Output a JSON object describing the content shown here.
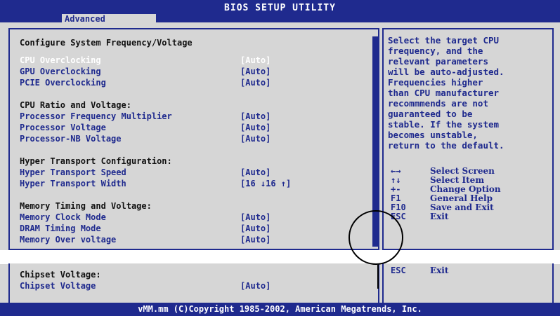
{
  "header": {
    "title": "BIOS SETUP UTILITY",
    "active_tab": "Advanced"
  },
  "main": {
    "heading": "Configure System Frequency/Voltage",
    "rows": [
      {
        "label": "CPU Overclocking",
        "value": "[Auto]",
        "selected": true
      },
      {
        "label": "GPU Overclocking",
        "value": "[Auto]"
      },
      {
        "label": "PCIE Overclocking",
        "value": "[Auto]"
      },
      {
        "section": "CPU Ratio and Voltage:"
      },
      {
        "label": "Processor Frequency Multiplier",
        "value": "[Auto]"
      },
      {
        "label": "Processor Voltage",
        "value": "[Auto]"
      },
      {
        "label": "Processor-NB Voltage",
        "value": "[Auto]"
      },
      {
        "section": "Hyper Transport Configuration:"
      },
      {
        "label": "Hyper Transport Speed",
        "value": "[Auto]"
      },
      {
        "label": "Hyper Transport Width",
        "value": "[16 ↓16 ↑]"
      },
      {
        "section": "Memory Timing and Voltage:"
      },
      {
        "label": "Memory Clock Mode",
        "value": "[Auto]"
      },
      {
        "label": "DRAM Timing Mode",
        "value": "[Auto]"
      },
      {
        "label": "Memory Over voltage",
        "value": "[Auto]"
      }
    ]
  },
  "help": {
    "lines": [
      "Select the target CPU",
      "frequency, and the",
      "relevant parameters",
      "will be auto-adjusted.",
      "Frequencies higher",
      "than CPU manufacturer",
      "recommmends are not",
      "guaranteed to be",
      "stable. If the system",
      "becomes unstable,",
      "return to the default."
    ],
    "keys": [
      {
        "key": "←→",
        "desc": "Select Screen"
      },
      {
        "key": "↑↓",
        "desc": "Select Item"
      },
      {
        "key": "+-",
        "desc": "Change Option"
      },
      {
        "key": "F1",
        "desc": "General Help"
      },
      {
        "key": "F10",
        "desc": "Save and Exit"
      },
      {
        "key": "ESC",
        "desc": "Exit"
      }
    ]
  },
  "bottom": {
    "section": "Chipset Voltage:",
    "row": {
      "label": "Chipset Voltage",
      "value": "[Auto]"
    },
    "help_key": "ESC",
    "help_desc": "Exit"
  },
  "footer": {
    "copyright": "vMM.mm (C)Copyright 1985-2002, American Megatrends, Inc."
  },
  "colors": {
    "bios_blue": "#1f2a8e",
    "bios_gray": "#d6d6d6",
    "selected_text": "#ffffff"
  }
}
